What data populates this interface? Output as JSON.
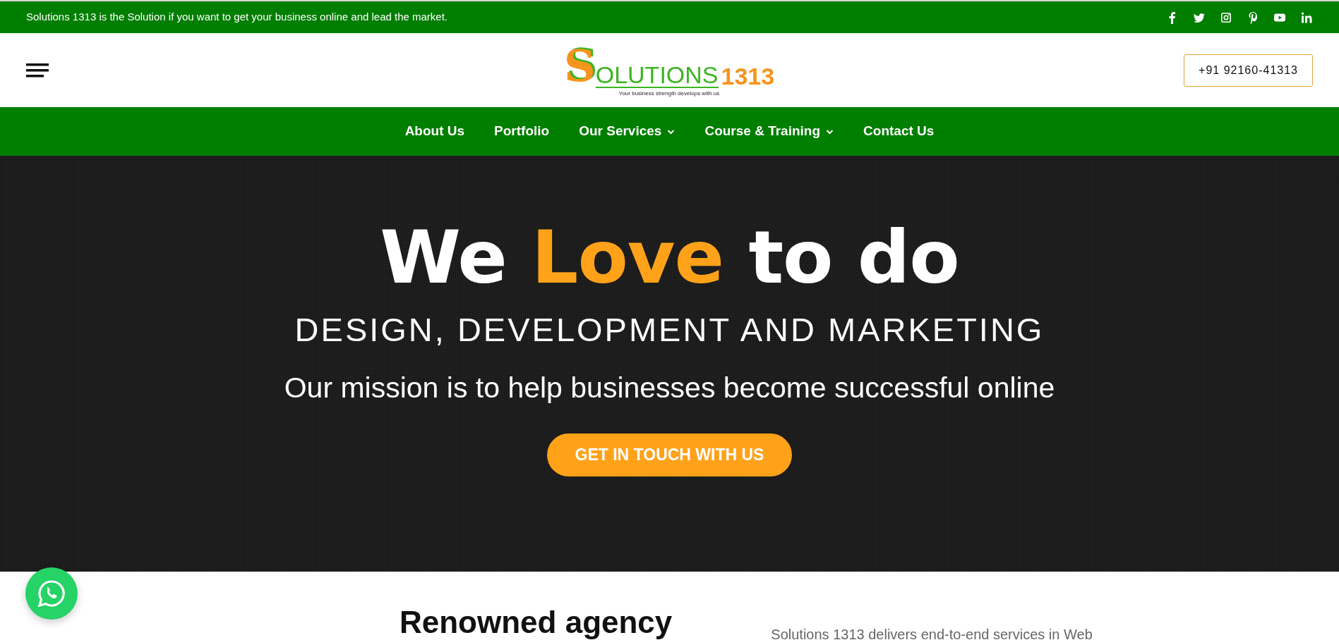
{
  "top_bar": {
    "message": "Solutions 1313 is the Solution if you want to get your business online and lead the market."
  },
  "header": {
    "logo": {
      "initial": "S",
      "word": "OLUTIONS",
      "number": "1313",
      "tagline": "Your business strength develops with us"
    },
    "phone": "+91 92160-41313"
  },
  "nav": [
    {
      "label": "About Us",
      "has_dropdown": false
    },
    {
      "label": "Portfolio",
      "has_dropdown": false
    },
    {
      "label": "Our Services",
      "has_dropdown": true
    },
    {
      "label": "Course & Training",
      "has_dropdown": true
    },
    {
      "label": "Contact Us",
      "has_dropdown": false
    }
  ],
  "hero": {
    "title": [
      {
        "text": "We",
        "highlight": false
      },
      {
        "text": "Love",
        "highlight": true
      },
      {
        "text": "to do",
        "highlight": false
      }
    ],
    "subtitle": "DESIGN, DEVELOPMENT AND MARKETING",
    "mission": "Our mission is to help businesses become successful online",
    "button": "GET IN TOUCH WITH US"
  },
  "intro": {
    "heading": "Renowned agency",
    "text": "Solutions 1313 delivers end-to-end services in Web"
  }
}
